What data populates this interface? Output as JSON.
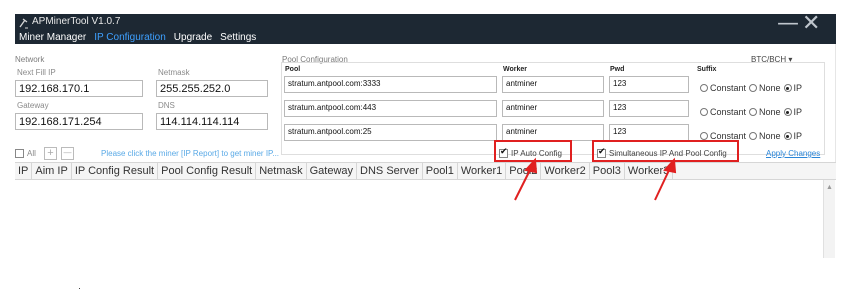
{
  "window": {
    "title": "APMinerTool V1.0.7",
    "minimize_glyph": "—",
    "close_glyph": "✕"
  },
  "menu": [
    "Miner Manager",
    "IP Configuration",
    "Upgrade",
    "Settings"
  ],
  "network": {
    "section_label": "Network",
    "next_fill_ip_label": "Next Fill IP",
    "next_fill_ip": "192.168.170.1",
    "netmask_label": "Netmask",
    "netmask": "255.255.252.0",
    "gateway_label": "Gateway",
    "gateway": "192.168.171.254",
    "dns_label": "DNS",
    "dns": "114.114.114.114"
  },
  "pool_config": {
    "section_label": "Pool Configuration",
    "coin": "BTC/BCH",
    "headers": {
      "pool": "Pool",
      "worker": "Worker",
      "pwd": "Pwd",
      "suffix": "Suffix"
    },
    "rows": [
      {
        "pool": "stratum.antpool.com:3333",
        "worker": "antminer",
        "pwd": "123",
        "suffix": "IP"
      },
      {
        "pool": "stratum.antpool.com:443",
        "worker": "antminer",
        "pwd": "123",
        "suffix": "IP"
      },
      {
        "pool": "stratum.antpool.com:25",
        "worker": "antminer",
        "pwd": "123",
        "suffix": "IP"
      }
    ],
    "suffix_options": [
      "Constant",
      "None",
      "IP"
    ]
  },
  "toolbar": {
    "all_label": "All",
    "add_glyph": "+",
    "remove_glyph": "—",
    "hint": "Please click the miner [IP Report] to get miner IP...",
    "ip_auto_config": "IP Auto Config",
    "simultaneous": "Simultaneous IP And Pool Config",
    "apply": "Apply Changes"
  },
  "grid": {
    "columns": [
      "IP",
      "Aim IP",
      "IP Config Result",
      "Pool Config Result",
      "Netmask",
      "Gateway",
      "DNS Server",
      "Pool1",
      "Worker1",
      "Pool2",
      "Worker2",
      "Pool3",
      "Worker3"
    ]
  },
  "colors": {
    "titlebar": "#1d2833",
    "menu_active": "#3ea0ff",
    "highlight": "#e02020",
    "hint": "#59a9e6"
  },
  "icons": {
    "logo": "miner-pickaxe-icon",
    "scroll_up": "chevron-up-icon"
  },
  "stray_mark": "·"
}
